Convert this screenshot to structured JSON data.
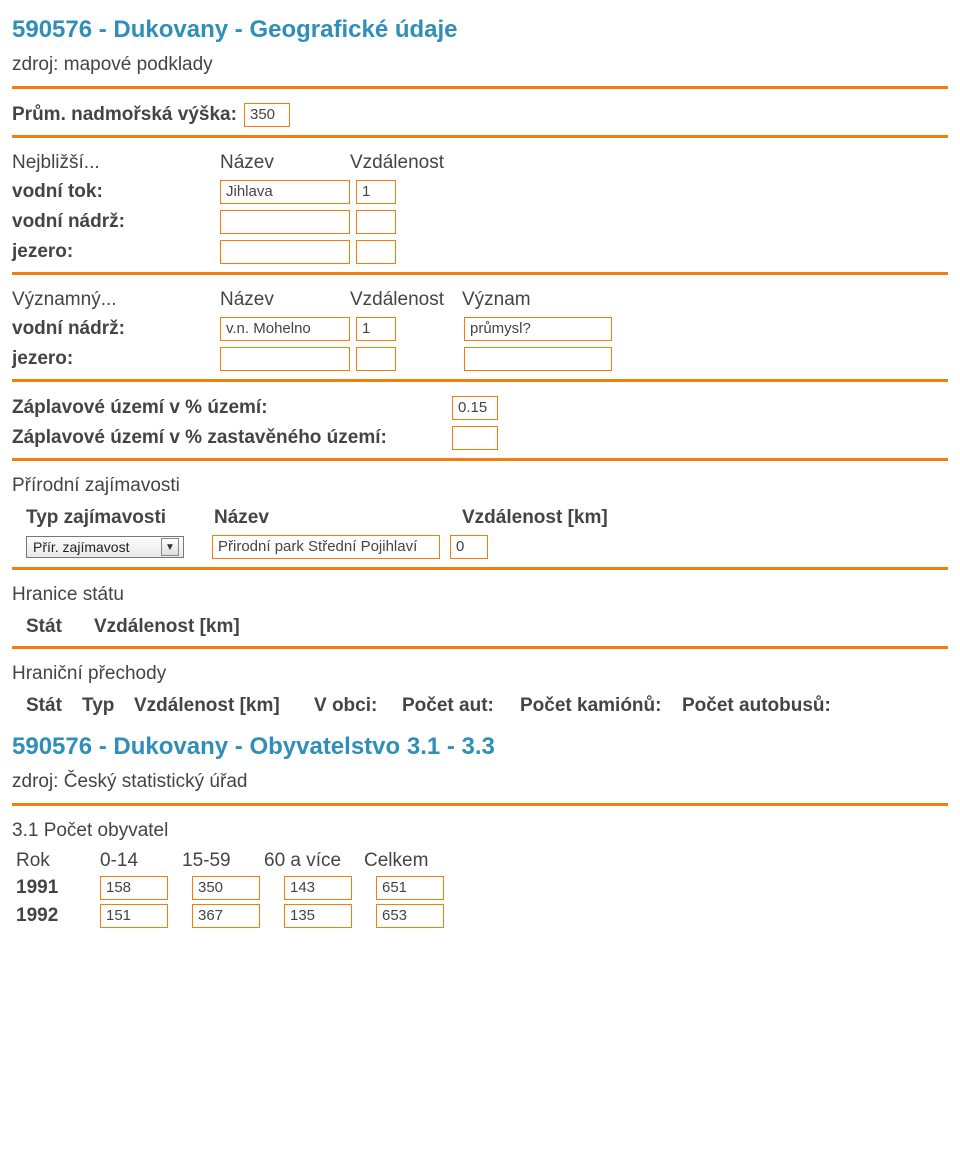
{
  "geo": {
    "heading": "590576 - Dukovany - Geografické údaje",
    "source": "zdroj: mapové podklady",
    "altitude": {
      "label": "Prům. nadmořská výška:",
      "value": "350"
    },
    "nearest": {
      "head": "Nejbližší...",
      "col_name": "Název",
      "col_dist": "Vzdálenost",
      "rows": {
        "watercourse": {
          "label": "vodní tok:",
          "name": "Jihlava",
          "dist": "1"
        },
        "reservoir": {
          "label": "vodní nádrž:",
          "name": "",
          "dist": ""
        },
        "lake": {
          "label": "jezero:",
          "name": "",
          "dist": ""
        }
      }
    },
    "significant": {
      "head": "Významný...",
      "col_name": "Název",
      "col_dist": "Vzdálenost",
      "col_sig": "Význam",
      "rows": {
        "reservoir": {
          "label": "vodní nádrž:",
          "name": "v.n. Mohelno",
          "dist": "1",
          "sig": "průmysl?"
        },
        "lake": {
          "label": "jezero:",
          "name": "",
          "dist": "",
          "sig": ""
        }
      }
    },
    "flood": {
      "territory": {
        "label": "Záplavové území v % území:",
        "value": "0.15"
      },
      "builtup": {
        "label": "Záplavové území v % zastavěného území:",
        "value": ""
      }
    },
    "attractions": {
      "title": "Přírodní zajímavosti",
      "th_type": "Typ zajímavosti",
      "th_name": "Název",
      "th_dist": "Vzdálenost [km]",
      "row1": {
        "type": "Přír. zajímavost",
        "name": "Přirodní park Střední Pojihlaví",
        "dist": "0"
      }
    },
    "borders": {
      "title": "Hranice státu",
      "th_state": "Stát",
      "th_dist": "Vzdálenost [km]"
    },
    "crossings": {
      "title": "Hraniční přechody",
      "th_state": "Stát",
      "th_type": "Typ",
      "th_dist": "Vzdálenost [km]",
      "th_obci": "V obci:",
      "th_cars": "Počet aut:",
      "th_trucks": "Počet kamiónů:",
      "th_buses": "Počet autobusů:"
    }
  },
  "pop": {
    "heading": "590576 - Dukovany - Obyvatelstvo 3.1 - 3.3",
    "source": "zdroj: Český statistický úřad",
    "section31": "3.1 Počet obyvatel",
    "head": {
      "year": "Rok",
      "a": "0-14",
      "b": "15-59",
      "c": "60 a více",
      "d": "Celkem"
    },
    "rows": {
      "r1991": {
        "year": "1991",
        "a": "158",
        "b": "350",
        "c": "143",
        "d": "651"
      },
      "r1992": {
        "year": "1992",
        "a": "151",
        "b": "367",
        "c": "135",
        "d": "653"
      }
    }
  }
}
